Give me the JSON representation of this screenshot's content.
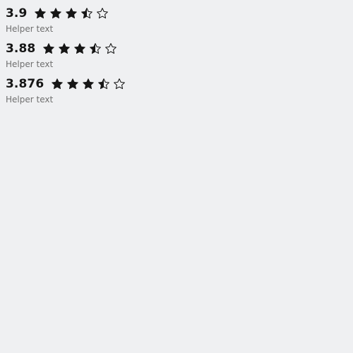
{
  "ratings": [
    {
      "value_label": "3.9",
      "value": 3.9,
      "max": 5,
      "helper": "Helper text"
    },
    {
      "value_label": "3.88",
      "value": 3.88,
      "max": 5,
      "helper": "Helper text"
    },
    {
      "value_label": "3.876",
      "value": 3.876,
      "max": 5,
      "helper": "Helper text"
    }
  ],
  "icons": {
    "full": "star-filled-icon",
    "half": "star-half-icon",
    "empty": "star-outline-icon"
  },
  "colors": {
    "background": "#eff0f2",
    "text": "#161616",
    "helper": "#6f6f6f",
    "star": "#161616"
  }
}
